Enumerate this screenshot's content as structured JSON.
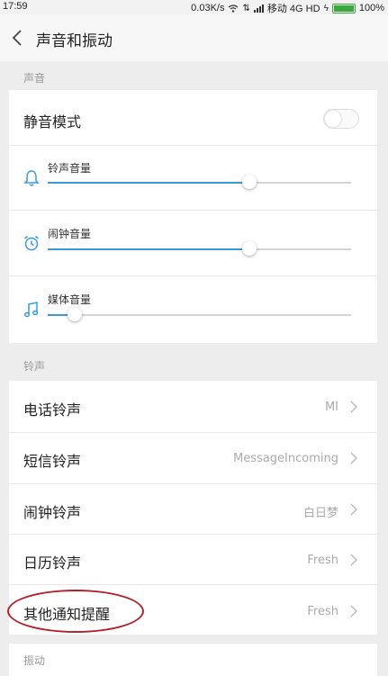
{
  "status": {
    "time": "17:59",
    "speed": "0.03K/s",
    "carrier": "移动 4G HD",
    "battery": "100%"
  },
  "header": {
    "title": "声音和振动"
  },
  "sections": {
    "sound": "声音",
    "ringtone": "铃声",
    "vibration": "振动"
  },
  "silent_mode": {
    "label": "静音模式",
    "enabled": false
  },
  "volumes": [
    {
      "label": "铃声音量",
      "icon": "bell-icon",
      "level": 0.665
    },
    {
      "label": "闹钟音量",
      "icon": "alarm-clock-icon",
      "level": 0.665
    },
    {
      "label": "媒体音量",
      "icon": "music-note-icon",
      "level": 0.09
    }
  ],
  "ringtones": [
    {
      "label": "电话铃声",
      "value": "MI"
    },
    {
      "label": "短信铃声",
      "value": "MessageIncoming"
    },
    {
      "label": "闹钟铃声",
      "value": "白日梦"
    },
    {
      "label": "日历铃声",
      "value": "Fresh"
    },
    {
      "label": "其他通知提醒",
      "value": "Fresh"
    }
  ],
  "colors": {
    "accent": "#3a9ad9",
    "highlight_oval": "#b0222a"
  }
}
